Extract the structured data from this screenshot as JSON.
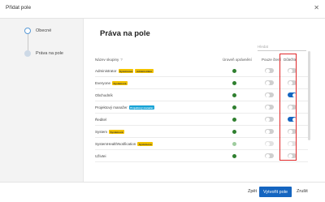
{
  "dialog": {
    "title": "Přidat pole",
    "close_icon": "close-icon"
  },
  "sidebar": {
    "steps": [
      {
        "label": "Obecné",
        "state": "done"
      },
      {
        "label": "Práva na pole",
        "state": "current"
      }
    ]
  },
  "main": {
    "title": "Práva na pole",
    "search_placeholder": "Hledat",
    "columns": {
      "name": "Název skupiny",
      "name_icon": "help-icon",
      "level": "Úroveň oprávnění",
      "read": "Pouze čtení",
      "important": "Důležité"
    },
    "rows": [
      {
        "name": "Administrator",
        "tags": [
          "Systémová",
          "Administrátor"
        ],
        "level": "active",
        "read": false,
        "important": false
      },
      {
        "name": "Everyone",
        "tags": [
          "Systémová"
        ],
        "level": "active",
        "read": false,
        "important": false
      },
      {
        "name": "Obchodník",
        "tags": [],
        "level": "active",
        "read": false,
        "important": true
      },
      {
        "name": "Projektový manažer",
        "tags": [
          "Projektový manažer"
        ],
        "level": "active",
        "read": false,
        "important": false
      },
      {
        "name": "Ředitel",
        "tags": [],
        "level": "active",
        "read": false,
        "important": true
      },
      {
        "name": "System",
        "tags": [
          "Systémová"
        ],
        "level": "active",
        "read": false,
        "important": false
      },
      {
        "name": "SystemHealthNotification",
        "tags": [
          "Systémová"
        ],
        "level": "light",
        "read": false,
        "important": false
      },
      {
        "name": "Uživtei",
        "tags": [],
        "level": "active",
        "read": false,
        "important": false
      }
    ]
  },
  "footer": {
    "back": "Zpět",
    "create": "Vytvořit pole",
    "cancel": "Zrušit"
  },
  "colors": {
    "accent": "#1565c0",
    "tag_yellow": "#f2c200",
    "tag_blue": "#16a3d6",
    "level_green": "#2f7f2f",
    "highlight": "#e0282a"
  }
}
